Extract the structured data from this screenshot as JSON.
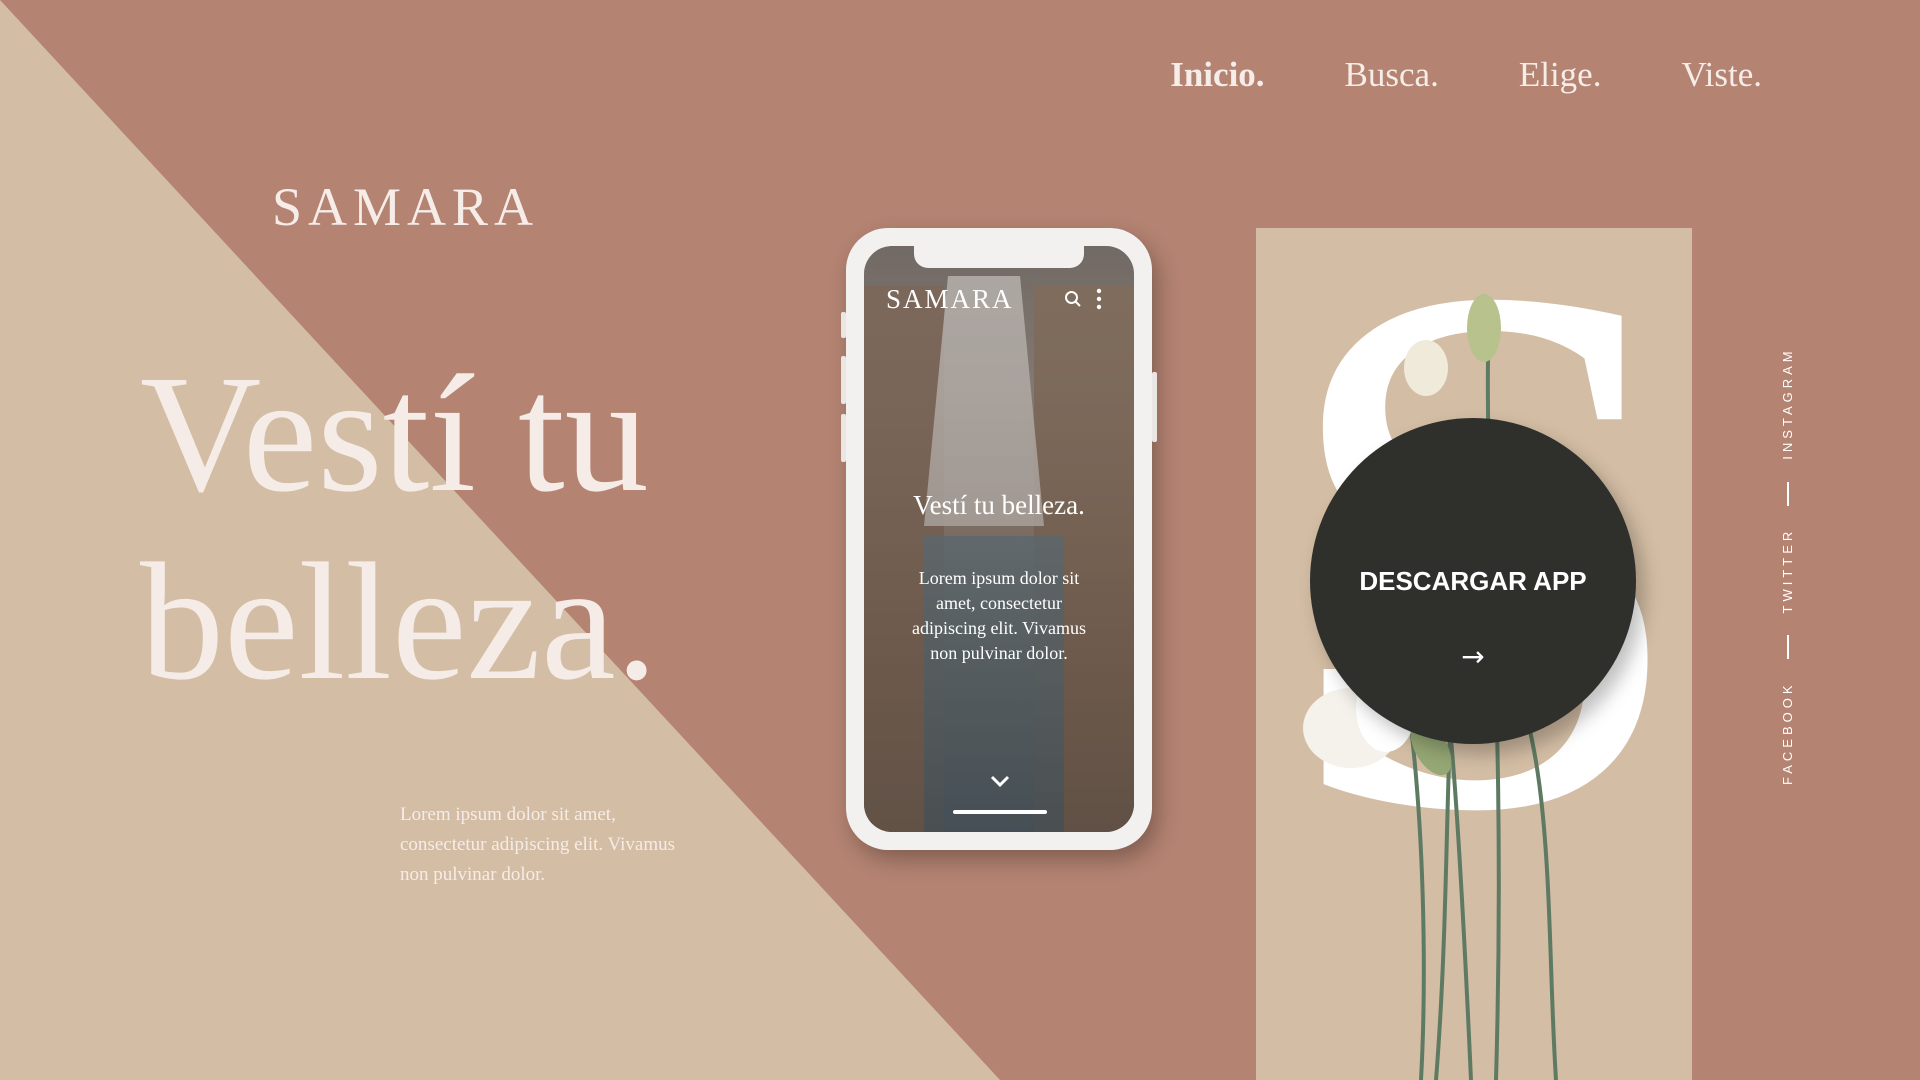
{
  "nav": {
    "items": [
      "Inicio.",
      "Busca.",
      "Elige.",
      "Viste."
    ],
    "active": "Inicio."
  },
  "brand": "SAMARA",
  "hero": {
    "line1": "Vestí tu",
    "line2": "belleza.",
    "description": "Lorem ipsum dolor sit amet, consectetur adipiscing elit. Vivamus non pulvinar dolor."
  },
  "phone": {
    "brand": "SAMARA",
    "title": "Vestí tu belleza.",
    "body": "Lorem ipsum dolor sit amet, consectetur adipiscing elit. Vivamus non pulvinar dolor.",
    "icons": [
      "search-icon",
      "more-vertical-icon",
      "chevron-down-icon"
    ]
  },
  "panel": {
    "letter": "S",
    "cta_label": "DESCARGAR APP",
    "cta_arrow": "→"
  },
  "social": {
    "links": [
      "FACEBOOK",
      "TWITTER",
      "INSTAGRAM"
    ]
  },
  "colors": {
    "background": "#b48372",
    "triangle": "#d3bda4",
    "panel": "#d3bda4",
    "cta": "#2f302c",
    "text_light": "#f6ece8"
  }
}
